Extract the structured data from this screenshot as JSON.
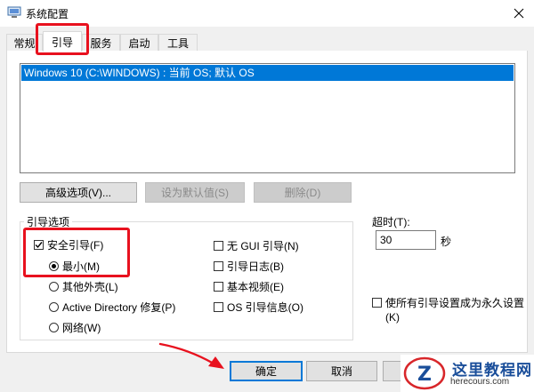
{
  "window": {
    "title": "系统配置"
  },
  "tabs": [
    {
      "label": "常规"
    },
    {
      "label": "引导"
    },
    {
      "label": "服务"
    },
    {
      "label": "启动"
    },
    {
      "label": "工具"
    }
  ],
  "os_list": {
    "items": [
      {
        "label": "Windows 10 (C:\\WINDOWS) : 当前 OS; 默认 OS",
        "selected": true
      }
    ]
  },
  "buttons": {
    "advanced": "高级选项(V)...",
    "set_default": "设为默认值(S)",
    "delete": "删除(D)",
    "ok": "确定",
    "cancel": "取消"
  },
  "boot_options": {
    "title": "引导选项",
    "safe_boot": {
      "label": "安全引导(F)",
      "checked": true
    },
    "minimal": {
      "label": "最小(M)",
      "selected": true
    },
    "alternate_shell": {
      "label": "其他外壳(L)",
      "selected": false
    },
    "active_directory": {
      "label": "Active Directory 修复(P)",
      "selected": false
    },
    "network": {
      "label": "网络(W)",
      "selected": false
    },
    "no_gui": {
      "label": "无 GUI 引导(N)",
      "checked": false
    },
    "boot_log": {
      "label": "引导日志(B)",
      "checked": false
    },
    "base_video": {
      "label": "基本视频(E)",
      "checked": false
    },
    "os_boot_info": {
      "label": "OS 引导信息(O)",
      "checked": false
    }
  },
  "timeout": {
    "label": "超时(T):",
    "value": "30",
    "unit": "秒"
  },
  "permanent": {
    "label_line1": "使所有引导设置成为永久设置",
    "label_line2": "(K)",
    "checked": false
  },
  "watermark": {
    "text": "这里教程网",
    "url": "herecours.com",
    "logo": "Z"
  },
  "colors": {
    "selection": "#0078d7",
    "highlight_box": "#e8111e",
    "arrow": "#e8111e"
  }
}
